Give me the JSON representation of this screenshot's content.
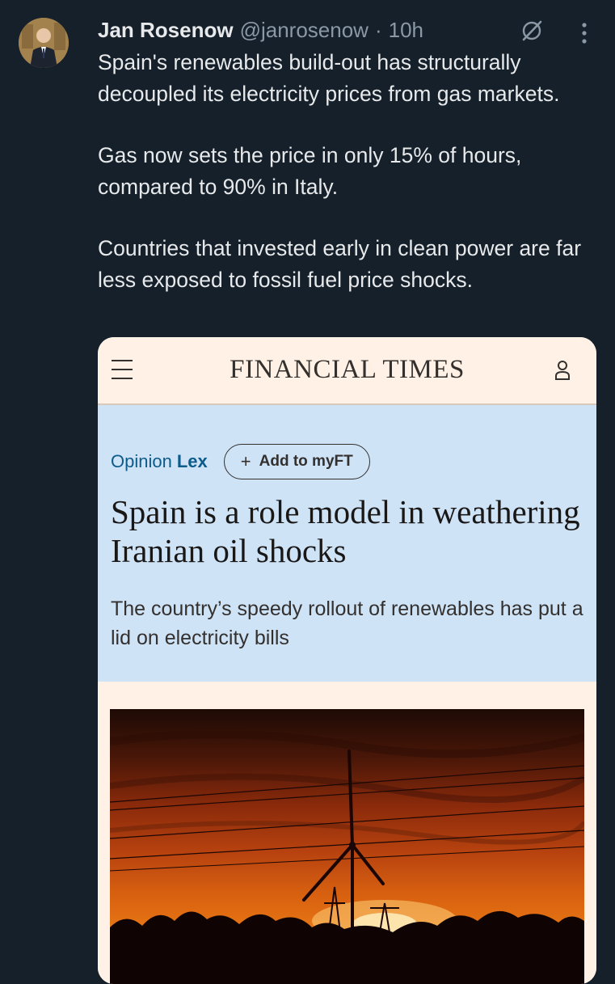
{
  "tweet": {
    "author_name": "Jan Rosenow",
    "handle": "@janrosenow",
    "separator": "·",
    "time": "10h",
    "paragraphs": [
      "Spain's renewables build-out has structurally decoupled its electricity prices from gas markets.",
      "Gas now sets the price in only 15% of hours, compared to 90% in Italy.",
      "Countries that invested early in clean power are far less exposed to fossil fuel price shocks."
    ],
    "icons": {
      "grok": "grok-icon",
      "more": "more-icon"
    }
  },
  "card": {
    "logo": "FINANCIAL TIMES",
    "section": "Opinion",
    "column": "Lex",
    "add_button": "Add to myFT",
    "add_plus": "+",
    "headline": "Spain is a role model in weathering Iranian oil shocks",
    "standfirst": "The country’s speedy rollout of renewables has put a lid on electricity bills",
    "icons": {
      "menu": "hamburger-icon",
      "account": "person-icon"
    }
  },
  "colors": {
    "background": "#15202b",
    "text_primary": "#e7e9ea",
    "text_secondary": "#8b98a5",
    "ft_paper": "#fff1e5",
    "ft_hero_blue": "#cfe3f7",
    "ft_link_blue": "#0d5b8a"
  }
}
